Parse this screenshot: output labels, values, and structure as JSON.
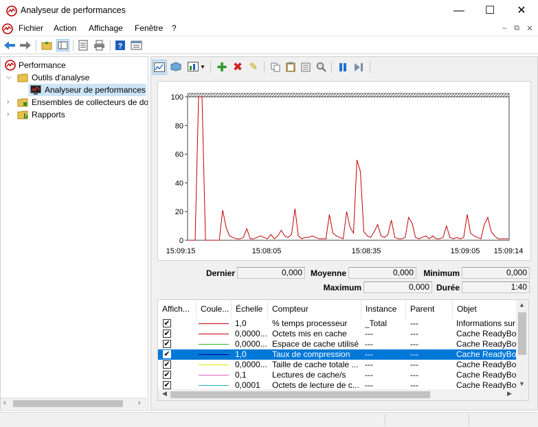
{
  "window": {
    "title": "Analyseur de performances",
    "minimize": "—",
    "maximize": "☐",
    "close": "✕"
  },
  "menu": {
    "items": [
      "Fichier",
      "Action",
      "Affichage",
      "Fenêtre",
      "?"
    ],
    "mdi_minimize": "–",
    "mdi_restore": "⧉",
    "mdi_close": "✕"
  },
  "tree": {
    "root": "Performance",
    "tools": "Outils d'analyse",
    "monitor": "Analyseur de performances",
    "collectors": "Ensembles de collecteurs de don",
    "reports": "Rapports"
  },
  "graph": {
    "times": [
      "15:09:15",
      "15:08:05",
      "15:08:35",
      "15:09:05",
      "15:09:14"
    ]
  },
  "chart_data": {
    "type": "line",
    "ylim": [
      0,
      100
    ],
    "yticks": [
      0,
      20,
      40,
      60,
      80,
      100
    ],
    "series": [
      {
        "color": "#c00000",
        "values": [
          0,
          0,
          0,
          100,
          100,
          0,
          0,
          0,
          0,
          0,
          21,
          9,
          3,
          2,
          1,
          1,
          2,
          8,
          1,
          1,
          2,
          3,
          2,
          1,
          4,
          1,
          3,
          7,
          3,
          2,
          4,
          22,
          3,
          1,
          2,
          2,
          3,
          2,
          1,
          1,
          1,
          18,
          5,
          3,
          2,
          1,
          20,
          9,
          5,
          56,
          48,
          6,
          3,
          2,
          6,
          11,
          3,
          2,
          4,
          14,
          2,
          1,
          1,
          2,
          16,
          12,
          2,
          1,
          2,
          3,
          1,
          3,
          1,
          1,
          2,
          10,
          2,
          1,
          2,
          1,
          2,
          18,
          5,
          3,
          2,
          1,
          11,
          16,
          6,
          3,
          1,
          1,
          1,
          1
        ]
      }
    ]
  },
  "stats": {
    "last_label": "Dernier",
    "last": "0,000",
    "avg_label": "Moyenne",
    "avg": "0,000",
    "min_label": "Minimum",
    "min": "0,000",
    "max_label": "Maximum",
    "max": "0,000",
    "duration_label": "Durée",
    "duration": "1:40"
  },
  "counters": {
    "columns": [
      "Affich...",
      "Coule...",
      "Échelle",
      "Compteur",
      "Instance",
      "Parent",
      "Objet"
    ],
    "rows": [
      {
        "scale": "1,0",
        "counter": "% temps processeur",
        "instance": "_Total",
        "parent": "---",
        "object": "Informations sur",
        "color": "#c00000",
        "check": "✔"
      },
      {
        "scale": "0,0000...",
        "counter": "Octets mis en cache",
        "instance": "---",
        "parent": "---",
        "object": "Cache ReadyBoo",
        "color": "#c00000",
        "check": "✔"
      },
      {
        "scale": "0,0000...",
        "counter": "Espace de cache utilisé",
        "instance": "---",
        "parent": "---",
        "object": "Cache ReadyBoo",
        "color": "#22bb22",
        "check": "✔"
      },
      {
        "scale": "1,0",
        "counter": "Taux de compression",
        "instance": "---",
        "parent": "---",
        "object": "Cache ReadyBoo",
        "color": "#00008b",
        "check": "✔"
      },
      {
        "scale": "0,0000...",
        "counter": "Taille de cache totale ...",
        "instance": "---",
        "parent": "---",
        "object": "Cache ReadyBoo",
        "color": "#e6e600",
        "check": "✔"
      },
      {
        "scale": "0,1",
        "counter": "Lectures de cache/s",
        "instance": "---",
        "parent": "---",
        "object": "Cache ReadyBoo",
        "color": "#e060c0",
        "check": "✔"
      },
      {
        "scale": "0,0001",
        "counter": "Octets de lecture de c...",
        "instance": "---",
        "parent": "---",
        "object": "Cache ReadyBoo",
        "color": "#20b0c0",
        "check": "✔"
      }
    ]
  }
}
